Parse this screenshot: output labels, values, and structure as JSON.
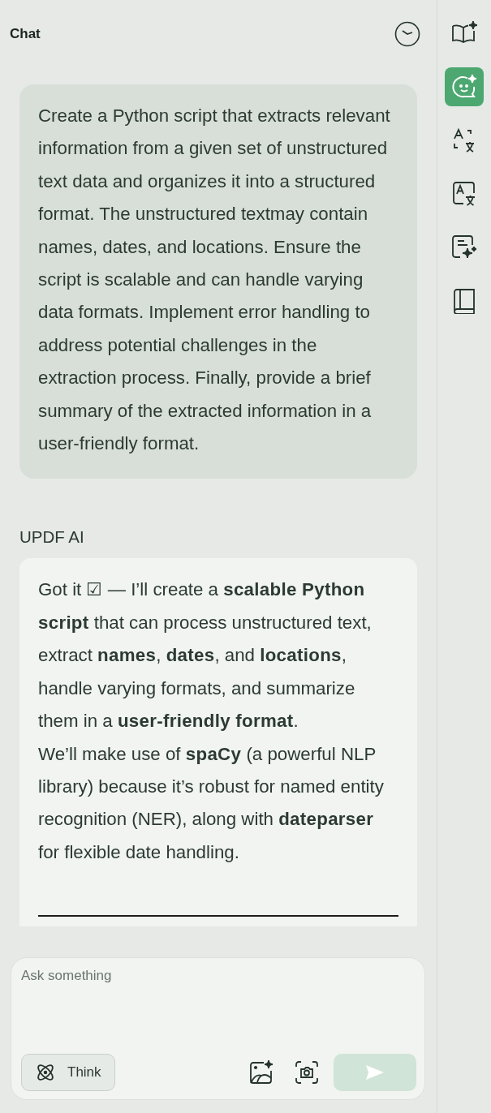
{
  "panel": {
    "title": "Chat"
  },
  "messages": [
    {
      "kind": "user",
      "paragraphs": [
        "Create a Python script that extracts relevant information from a given set of unstructured text data and organizes it into a structured format. The unstructured textmay contain names, dates, and locations. Ensure the script is scalable and can handle varying data formats. Implement error handling to address potential challenges in the extraction process. Finally, provide a brief summary of the extracted information in a user-friendly format."
      ]
    },
    {
      "kind": "assistant",
      "sender": "UPDF AI",
      "paragraphs": [
        "Got it ☑ — I’ll create a **scalable Python script** that can process unstructured text, extract **names**, **dates**, and **locations**, handle varying formats, and summarize them in a **user-friendly format**.",
        "We’ll make use of **spaCy** (a powerful NLP library) because it’s robust for named entity recognition (NER), along with **dateparser** for flexible date handling."
      ]
    }
  ],
  "composer": {
    "placeholder": "Ask something",
    "think": {
      "label": "Think",
      "on": false
    },
    "send": {
      "disabled": true
    }
  },
  "sidebar": {
    "items": [
      {
        "kind": "guide",
        "selected": false
      },
      {
        "kind": "chat",
        "selected": true
      },
      {
        "kind": "translate",
        "selected": false
      },
      {
        "kind": "translatebox",
        "selected": false
      },
      {
        "kind": "summary",
        "selected": false
      },
      {
        "kind": "book",
        "selected": false
      }
    ]
  }
}
